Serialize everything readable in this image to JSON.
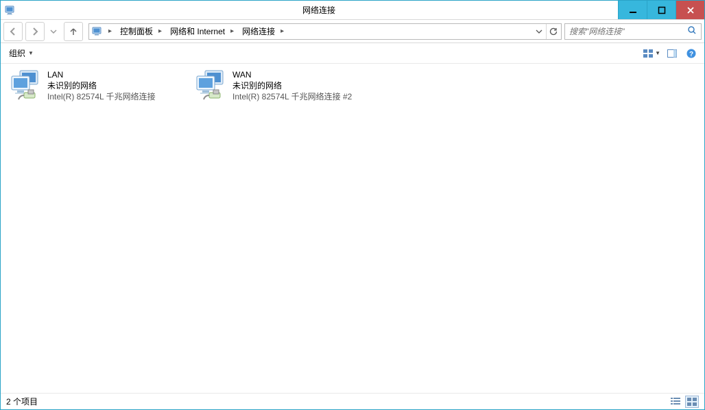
{
  "window": {
    "title": "网络连接"
  },
  "breadcrumbs": [
    "控制面板",
    "网络和 Internet",
    "网络连接"
  ],
  "search": {
    "placeholder": "搜索\"网络连接\""
  },
  "toolbar": {
    "organize": "组织"
  },
  "items": [
    {
      "name": "LAN",
      "status": "未识别的网络",
      "hw": "Intel(R) 82574L 千兆网络连接"
    },
    {
      "name": "WAN",
      "status": "未识别的网络",
      "hw": "Intel(R) 82574L 千兆网络连接 #2"
    }
  ],
  "status": {
    "count_text": "2 个项目"
  }
}
